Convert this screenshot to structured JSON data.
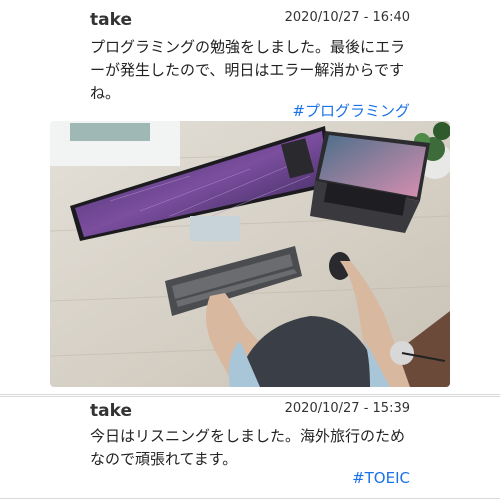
{
  "posts": [
    {
      "username": "take",
      "timestamp": "2020/10/27 - 16:40",
      "body": "プログラミングの勉強をしました。最後にエラーが発生したので、明日はエラー解消からですね。",
      "hashtag": "#プログラミング",
      "image": "desk-workspace-photo"
    },
    {
      "username": "take",
      "timestamp": "2020/10/27 - 15:39",
      "body": "今日はリスニングをしました。海外旅行のためなので頑張れてます。",
      "hashtag": "#TOEIC"
    }
  ],
  "colors": {
    "hashtag": "#1a73e8",
    "divider": "#d9d9d9"
  }
}
